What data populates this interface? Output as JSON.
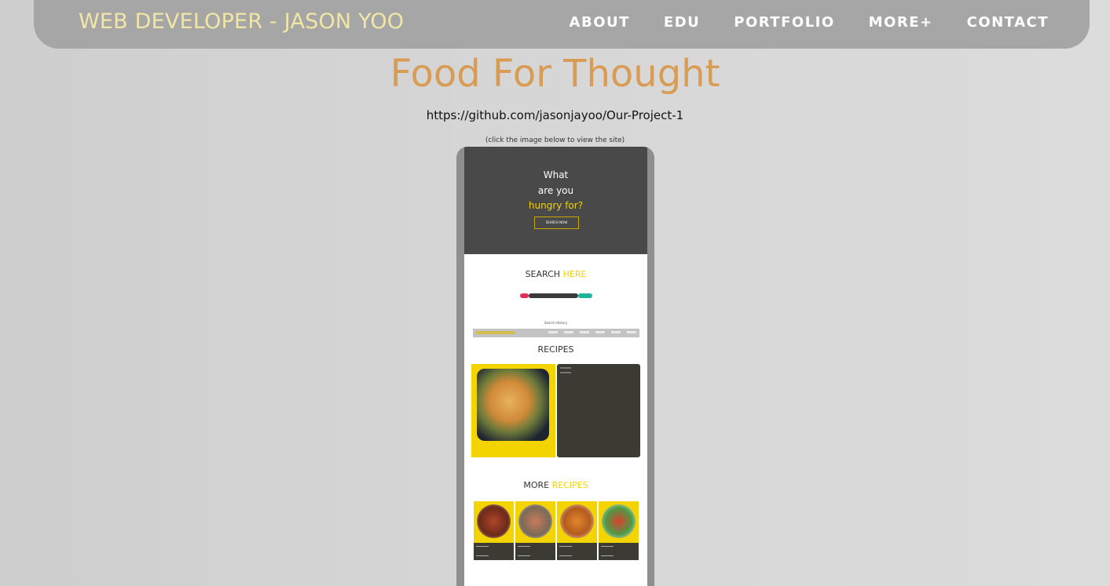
{
  "nav": {
    "brand": "WEB DEVELOPER - JASON YOO",
    "links": [
      "ABOUT",
      "EDU",
      "PORTFOLIO",
      "MORE+",
      "CONTACT"
    ]
  },
  "project": {
    "title": "Food For Thought",
    "repo_url": "https://github.com/jasonjayoo/Our-Project-1",
    "hint": "(click the image below to view the site)"
  },
  "preview": {
    "hero_line1": "What",
    "hero_line2": "are you",
    "hero_highlight": "hungry for?",
    "hero_button": "SEARCH NOW",
    "search_title": "SEARCH",
    "search_title_hl": "HERE",
    "history_label": "Search History",
    "recipes_title": "RECIPES",
    "more_title": "MORE",
    "more_title_hl": "RECIPES"
  },
  "colors": {
    "nav_bg": "#a6a6a6",
    "brand": "#f1e6a6",
    "title": "#d89c54",
    "accent_yellow": "#f3d400"
  }
}
